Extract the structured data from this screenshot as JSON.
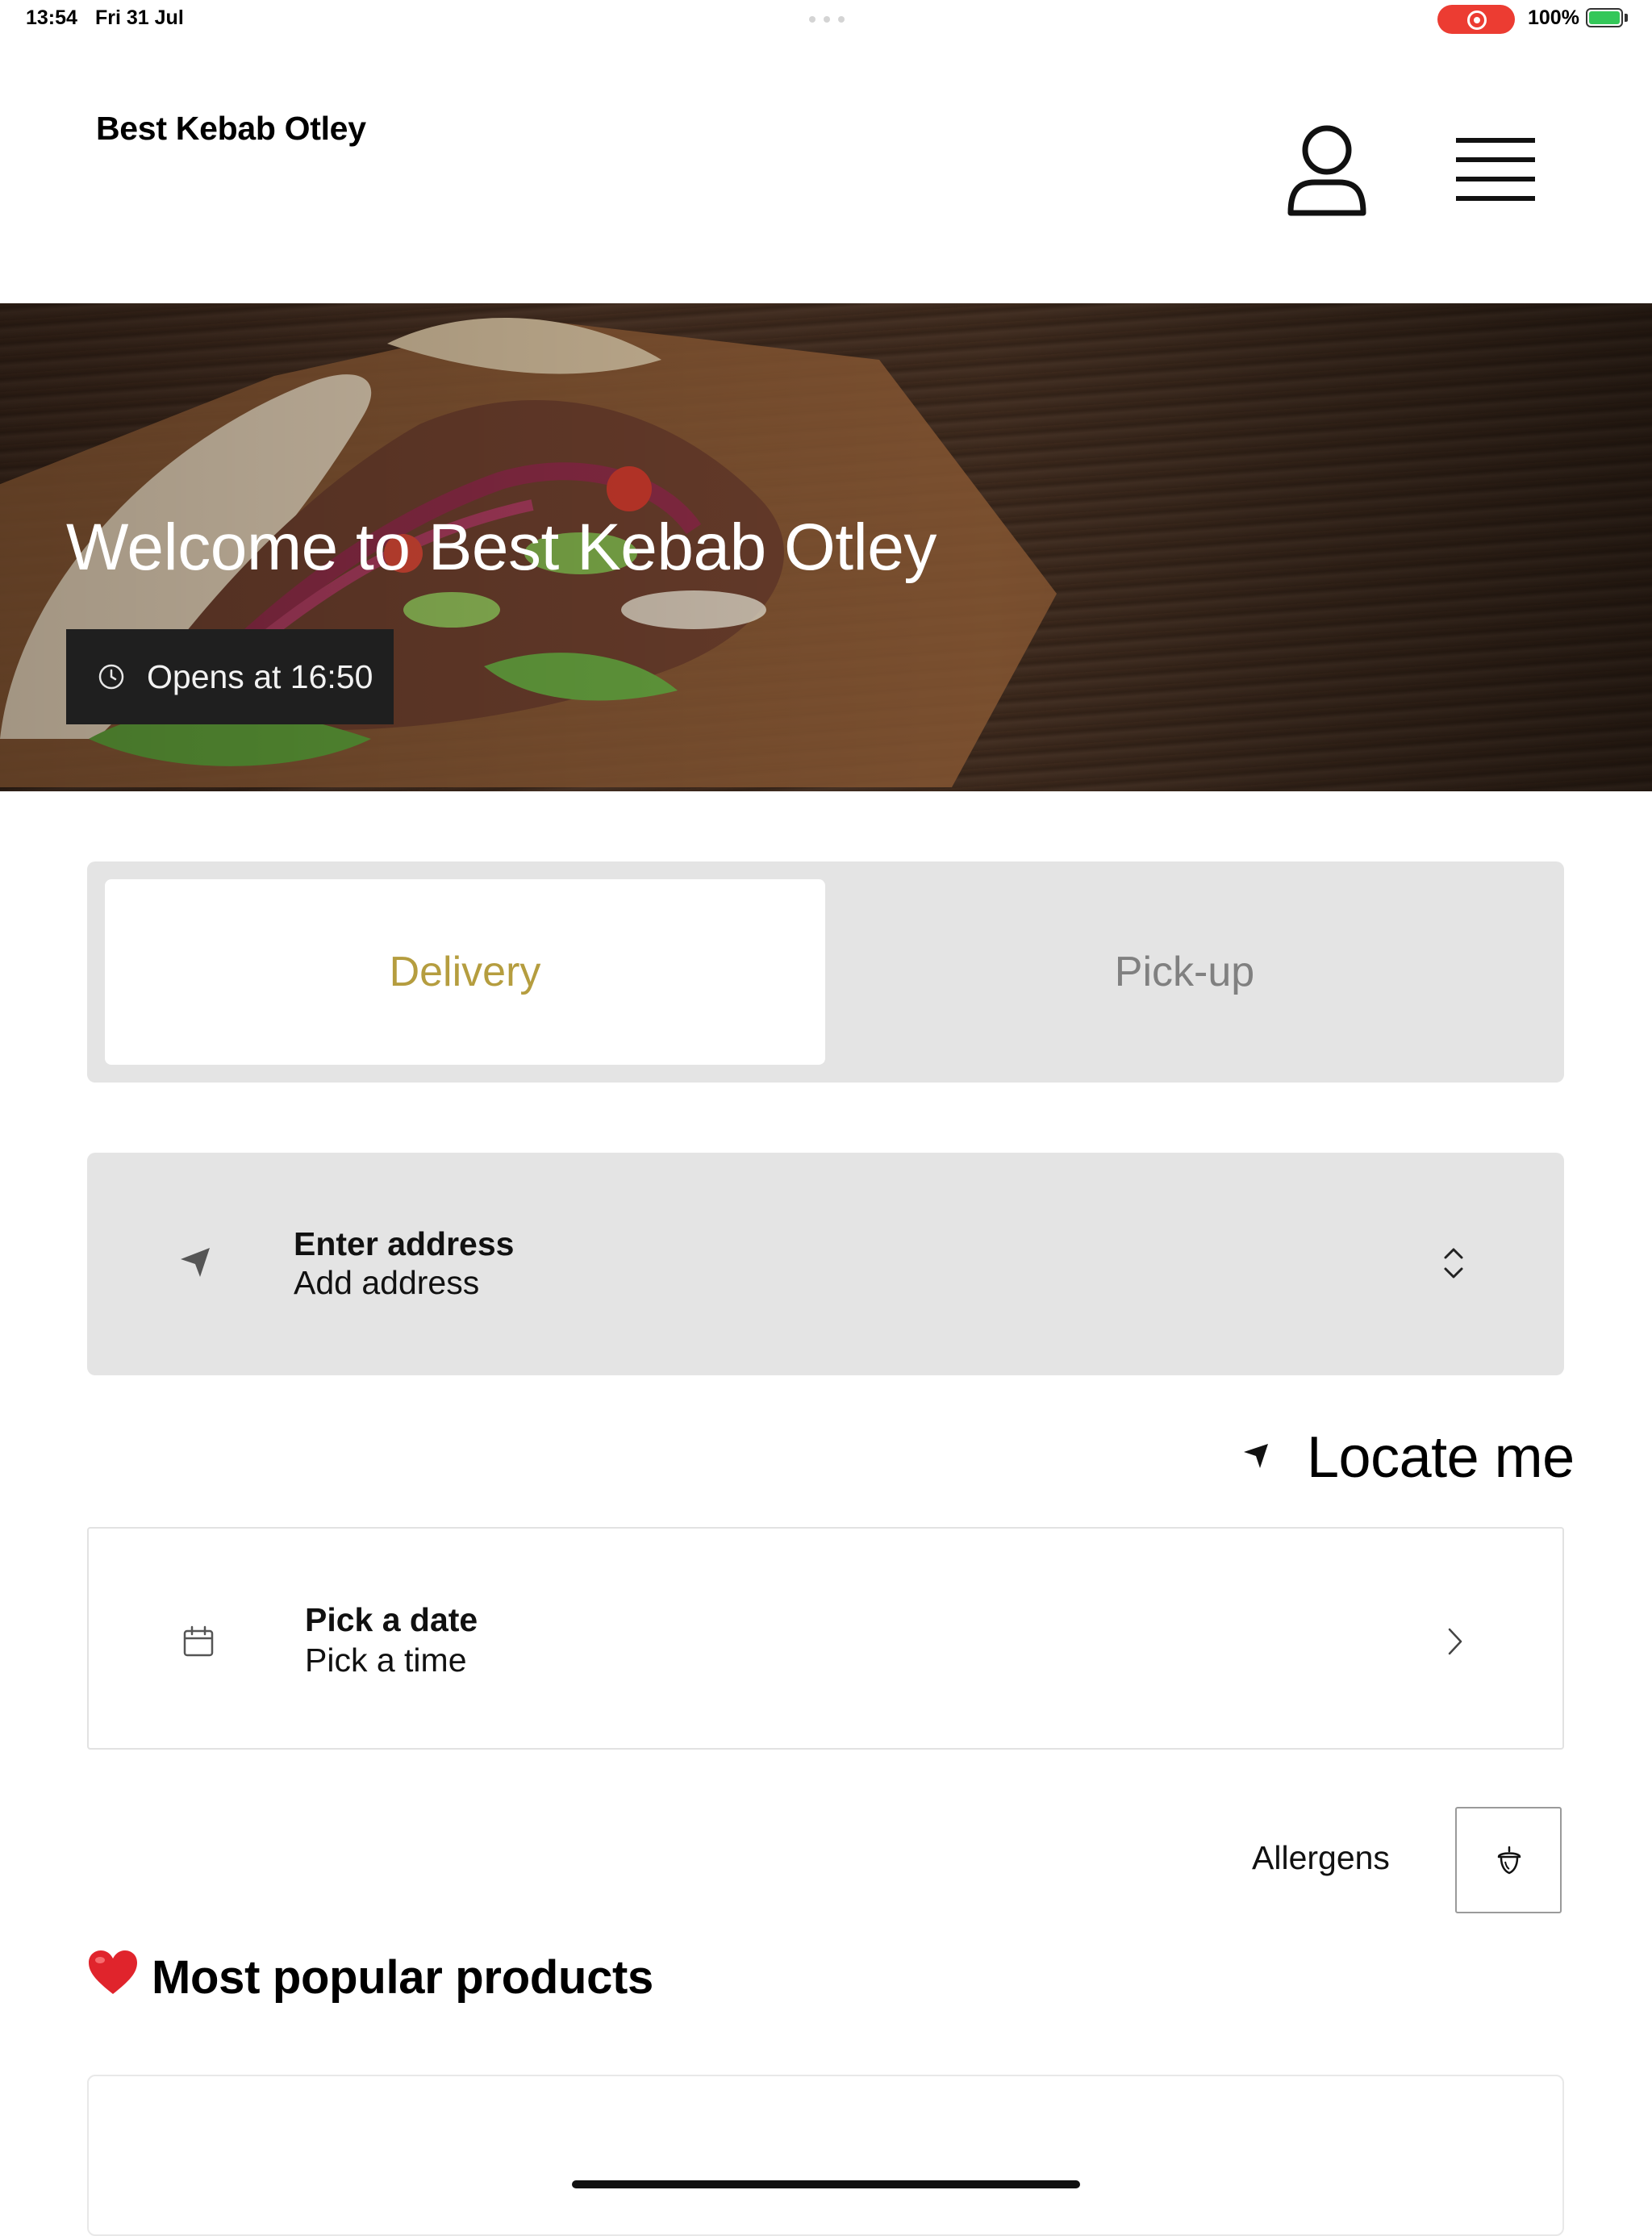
{
  "status_bar": {
    "time": "13:54",
    "date": "Fri 31 Jul",
    "battery": "100%",
    "recording_color": "#ec3c32",
    "battery_color": "#34c759"
  },
  "header": {
    "title": "Best Kebab Otley",
    "account_icon": "person-icon",
    "menu_icon": "hamburger-menu-icon"
  },
  "hero": {
    "title": "Welcome to Best Kebab Otley",
    "open_status": "Opens at 16:50",
    "status_icon": "clock-icon"
  },
  "order_mode": {
    "delivery": "Delivery",
    "pickup": "Pick-up",
    "selected": "Delivery",
    "accent_color": "#b59d3f"
  },
  "address": {
    "title": "Enter address",
    "subtitle": "Add address",
    "icon": "navigation-arrow-icon",
    "trailing_icon": "chevron-updown-icon"
  },
  "locate": {
    "label": "Locate me",
    "icon": "location-arrow-icon"
  },
  "schedule": {
    "title": "Pick a date",
    "subtitle": "Pick a time",
    "icon": "calendar-icon",
    "trailing_icon": "chevron-right-icon"
  },
  "allergens": {
    "label": "Allergens",
    "icon": "acorn-icon"
  },
  "popular": {
    "emoji": "❤️",
    "title": "Most popular products"
  }
}
